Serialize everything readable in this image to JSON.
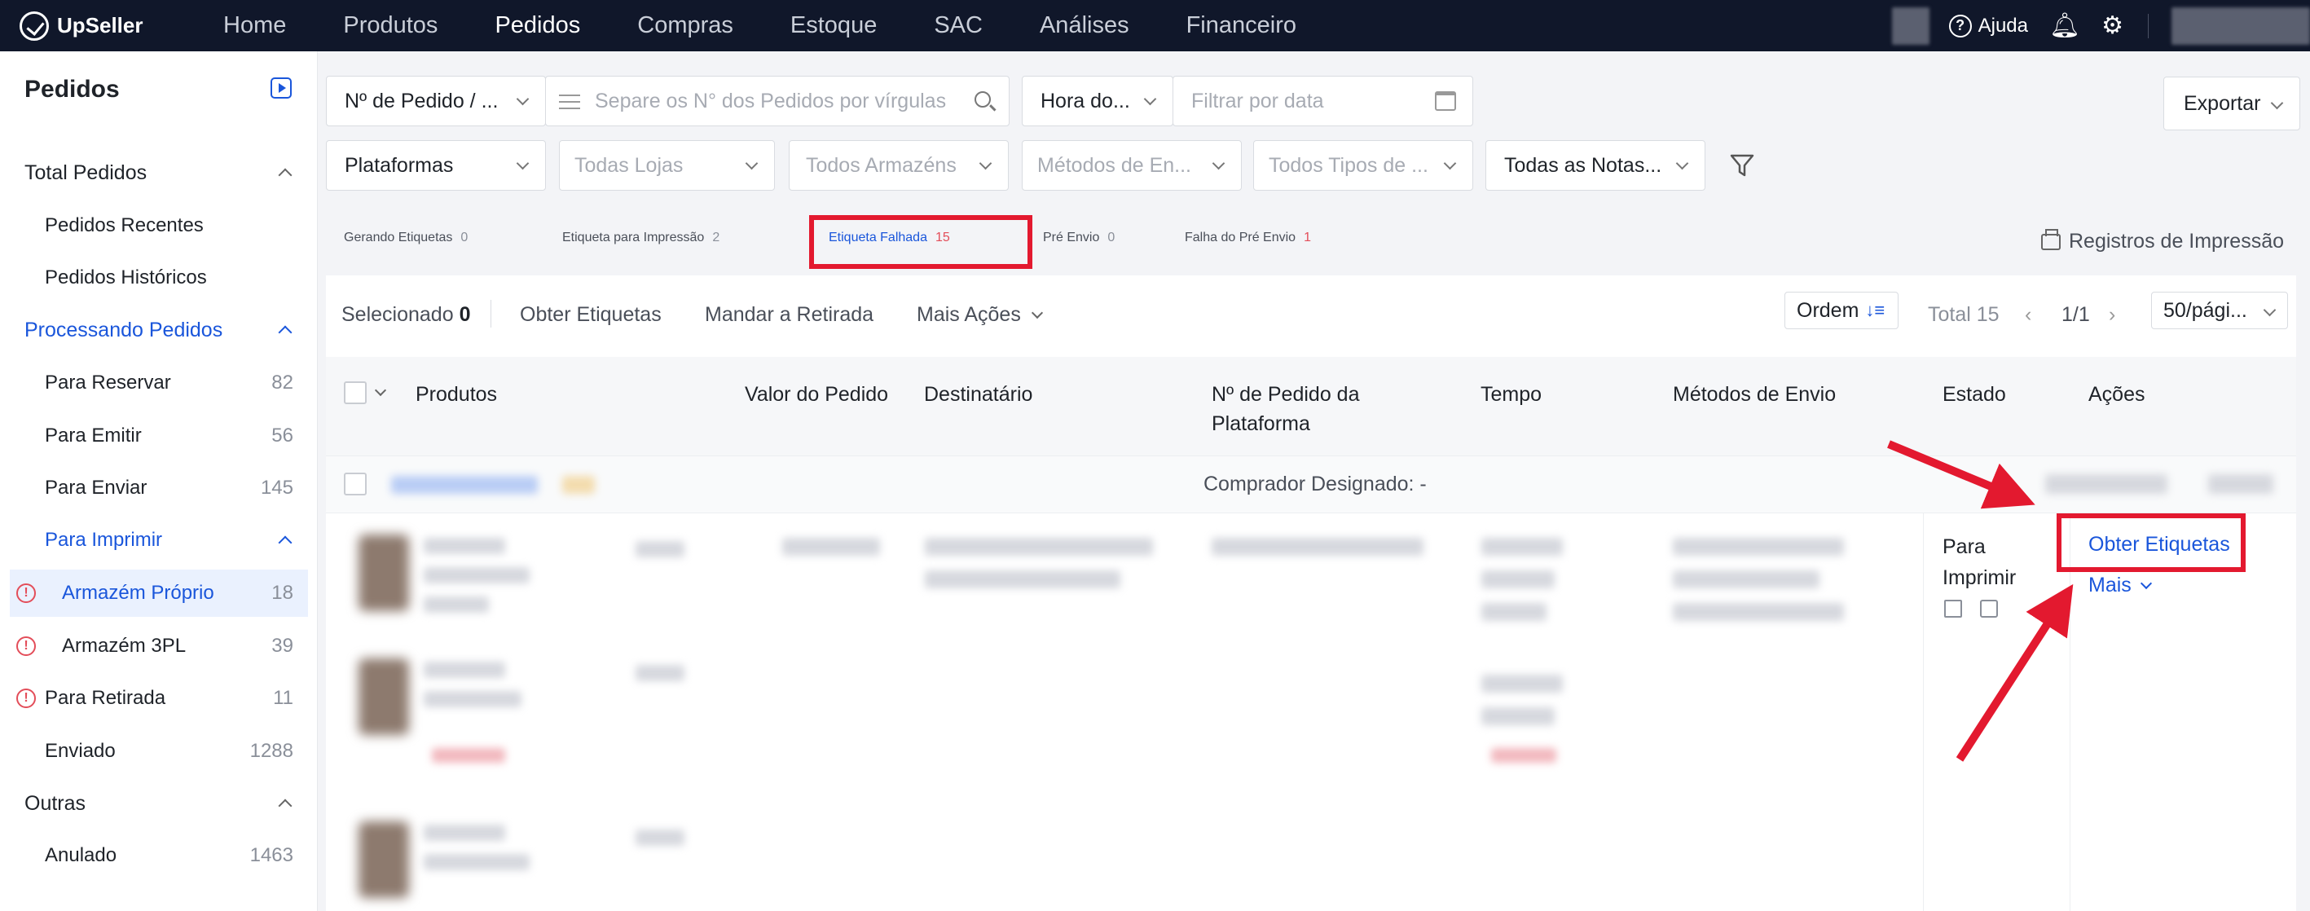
{
  "app": {
    "brand": "UpSeller"
  },
  "nav": {
    "items": [
      "Home",
      "Produtos",
      "Pedidos",
      "Compras",
      "Estoque",
      "SAC",
      "Análises",
      "Financeiro"
    ],
    "active": "Pedidos"
  },
  "topright": {
    "help": "Ajuda"
  },
  "sidebar": {
    "title": "Pedidos",
    "total_group": "Total Pedidos",
    "recent": "Pedidos Recentes",
    "history": "Pedidos Históricos",
    "processing_group": "Processando Pedidos",
    "items": [
      {
        "label": "Para Reservar",
        "count": "82"
      },
      {
        "label": "Para Emitir",
        "count": "56"
      },
      {
        "label": "Para Enviar",
        "count": "145"
      }
    ],
    "print_group": "Para Imprimir",
    "print_items": [
      {
        "label": "Armazém Próprio",
        "count": "18"
      },
      {
        "label": "Armazém 3PL",
        "count": "39"
      }
    ],
    "pickup": {
      "label": "Para Retirada",
      "count": "11"
    },
    "sent": {
      "label": "Enviado",
      "count": "1288"
    },
    "other_group": "Outras",
    "cancelled": {
      "label": "Anulado",
      "count": "1463"
    }
  },
  "filters": {
    "order_no": "Nº de Pedido / ...",
    "order_placeholder": "Separe os N° dos Pedidos por vírgulas",
    "time": "Hora do...",
    "date_placeholder": "Filtrar por data",
    "platforms": "Plataformas",
    "stores": "Todas Lojas",
    "warehouses": "Todos Armazéns",
    "ship_methods": "Métodos de En...",
    "types": "Todos Tipos de ...",
    "invoices": "Todas as Notas..."
  },
  "export": "Exportar",
  "tabs": [
    {
      "label": "Gerando Etiquetas",
      "count": "0"
    },
    {
      "label": "Etiqueta para Impressão",
      "count": "2"
    },
    {
      "label": "Etiqueta Falhada",
      "count": "15"
    },
    {
      "label": "Pré Envio",
      "count": "0"
    },
    {
      "label": "Falha do Pré Envio",
      "count": "1"
    }
  ],
  "print_records": "Registros de Impressão",
  "toolbar": {
    "selected": "Selecionado",
    "selected_count": "0",
    "get_labels": "Obter Etiquetas",
    "send_pickup": "Mandar a Retirada",
    "more_actions": "Mais Ações",
    "order": "Ordem",
    "total": "Total 15",
    "page": "1/1",
    "per_page": "50/pági..."
  },
  "table": {
    "headers": [
      "Produtos",
      "Valor do Pedido",
      "Destinatário",
      "Nº de Pedido da",
      "Plataforma",
      "Tempo",
      "Métodos de Envio",
      "Estado",
      "Ações"
    ],
    "group_label": "Comprador Designado: -",
    "row_state_line1": "Para",
    "row_state_line2": "Imprimir",
    "row_action": "Obter Etiquetas",
    "row_more": "Mais"
  }
}
